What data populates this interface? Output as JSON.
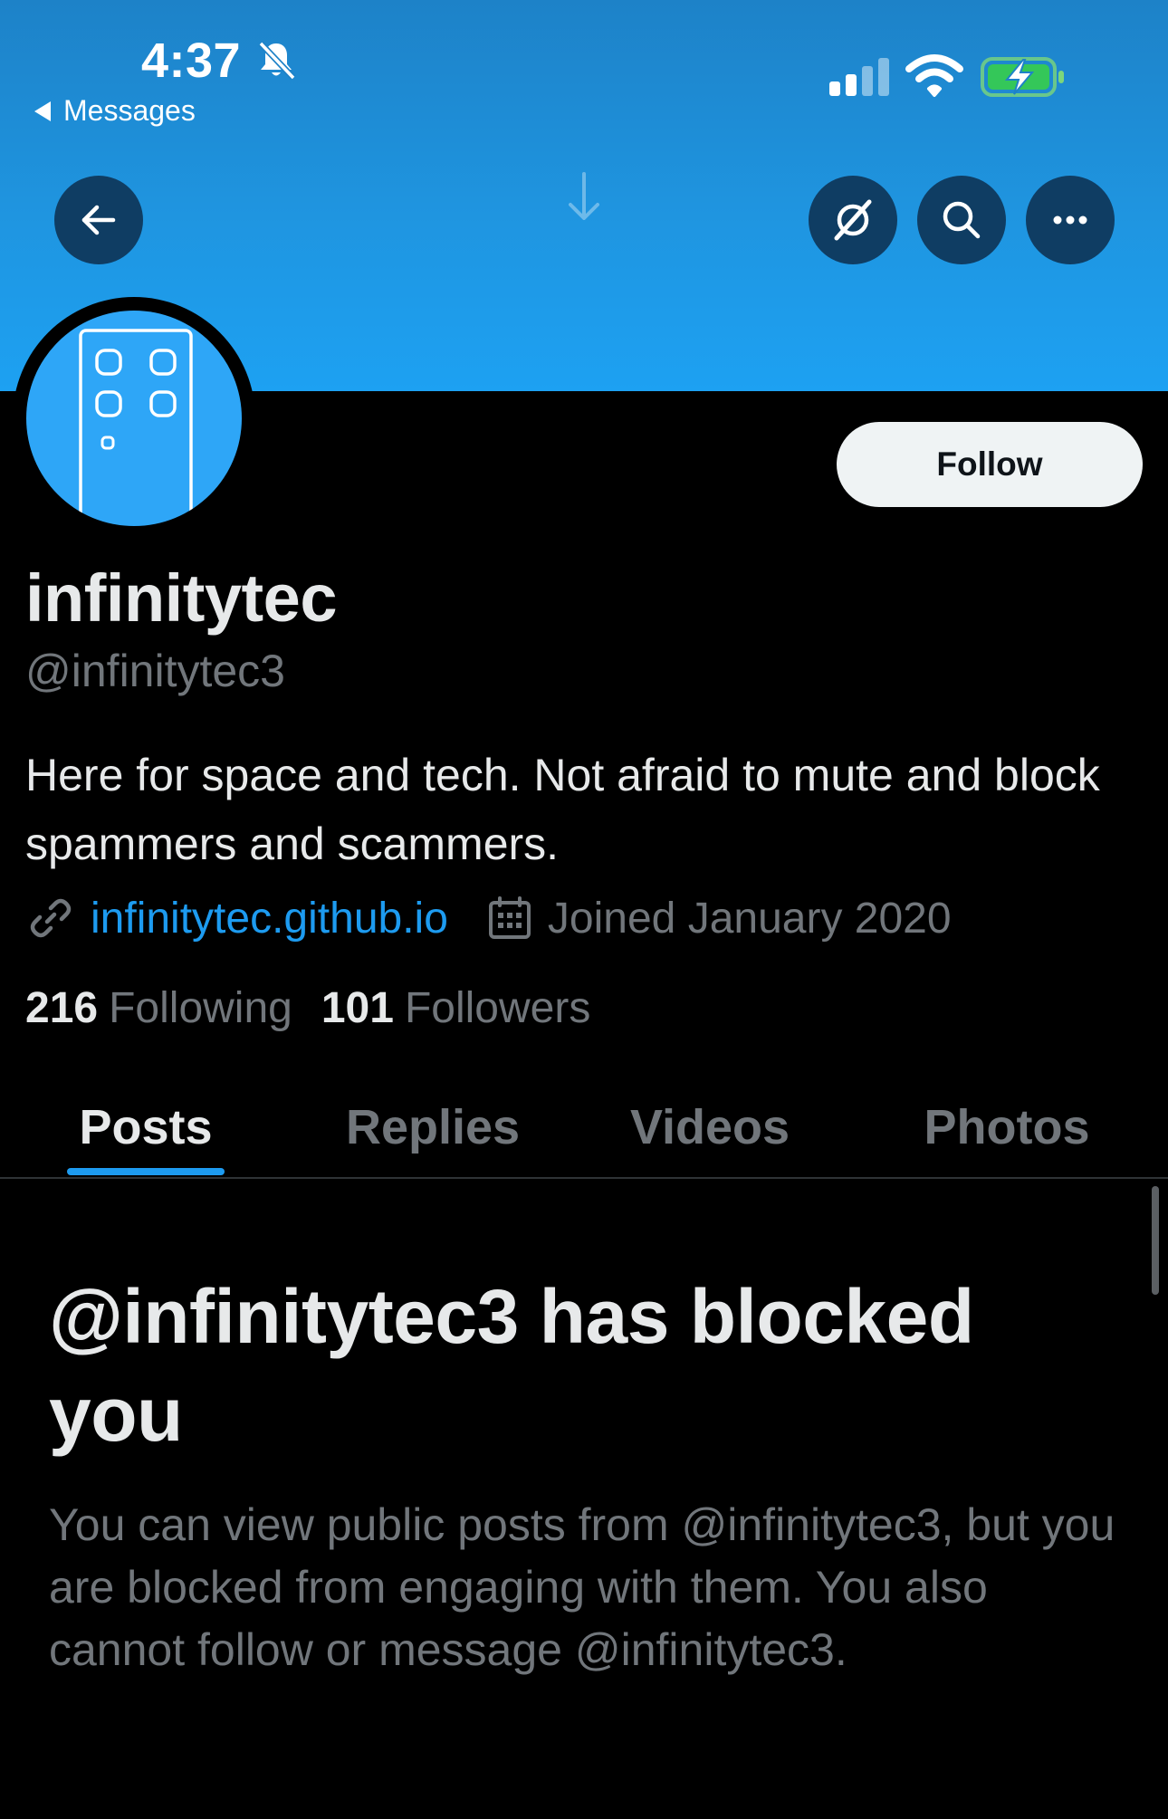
{
  "status_bar": {
    "time": "4:37",
    "back_app_label": "Messages",
    "icons": [
      "bell-slash-icon",
      "cellular-signal-icon",
      "wifi-icon",
      "battery-charging-icon"
    ]
  },
  "header": {
    "buttons": [
      "back-arrow-icon",
      "grok-icon",
      "search-icon",
      "more-icon"
    ],
    "pull_indicator": "down-arrow-icon"
  },
  "profile": {
    "display_name": "infinitytec",
    "handle": "@infinitytec3",
    "follow_label": "Follow",
    "bio": "Here for space and tech. Not afraid to mute and block spammers and scammers.",
    "website": "infinitytec.github.io",
    "joined": "Joined January 2020",
    "following_count": "216",
    "following_label": "Following",
    "followers_count": "101",
    "followers_label": "Followers"
  },
  "tabs": [
    {
      "label": "Posts",
      "active": true
    },
    {
      "label": "Replies",
      "active": false
    },
    {
      "label": "Videos",
      "active": false
    },
    {
      "label": "Photos",
      "active": false
    }
  ],
  "blocked_notice": {
    "title": "@infinitytec3 has blocked you",
    "body": "You can view public posts from @infinitytec3, but you are blocked from engaging with them. You also cannot follow or message @infinitytec3."
  },
  "colors": {
    "accent": "#1d9bf0",
    "banner": "#1da1f2",
    "background": "#000000",
    "text_primary": "#e7e9ea",
    "text_secondary": "#71767b",
    "follow_button_bg": "#eff3f4"
  }
}
